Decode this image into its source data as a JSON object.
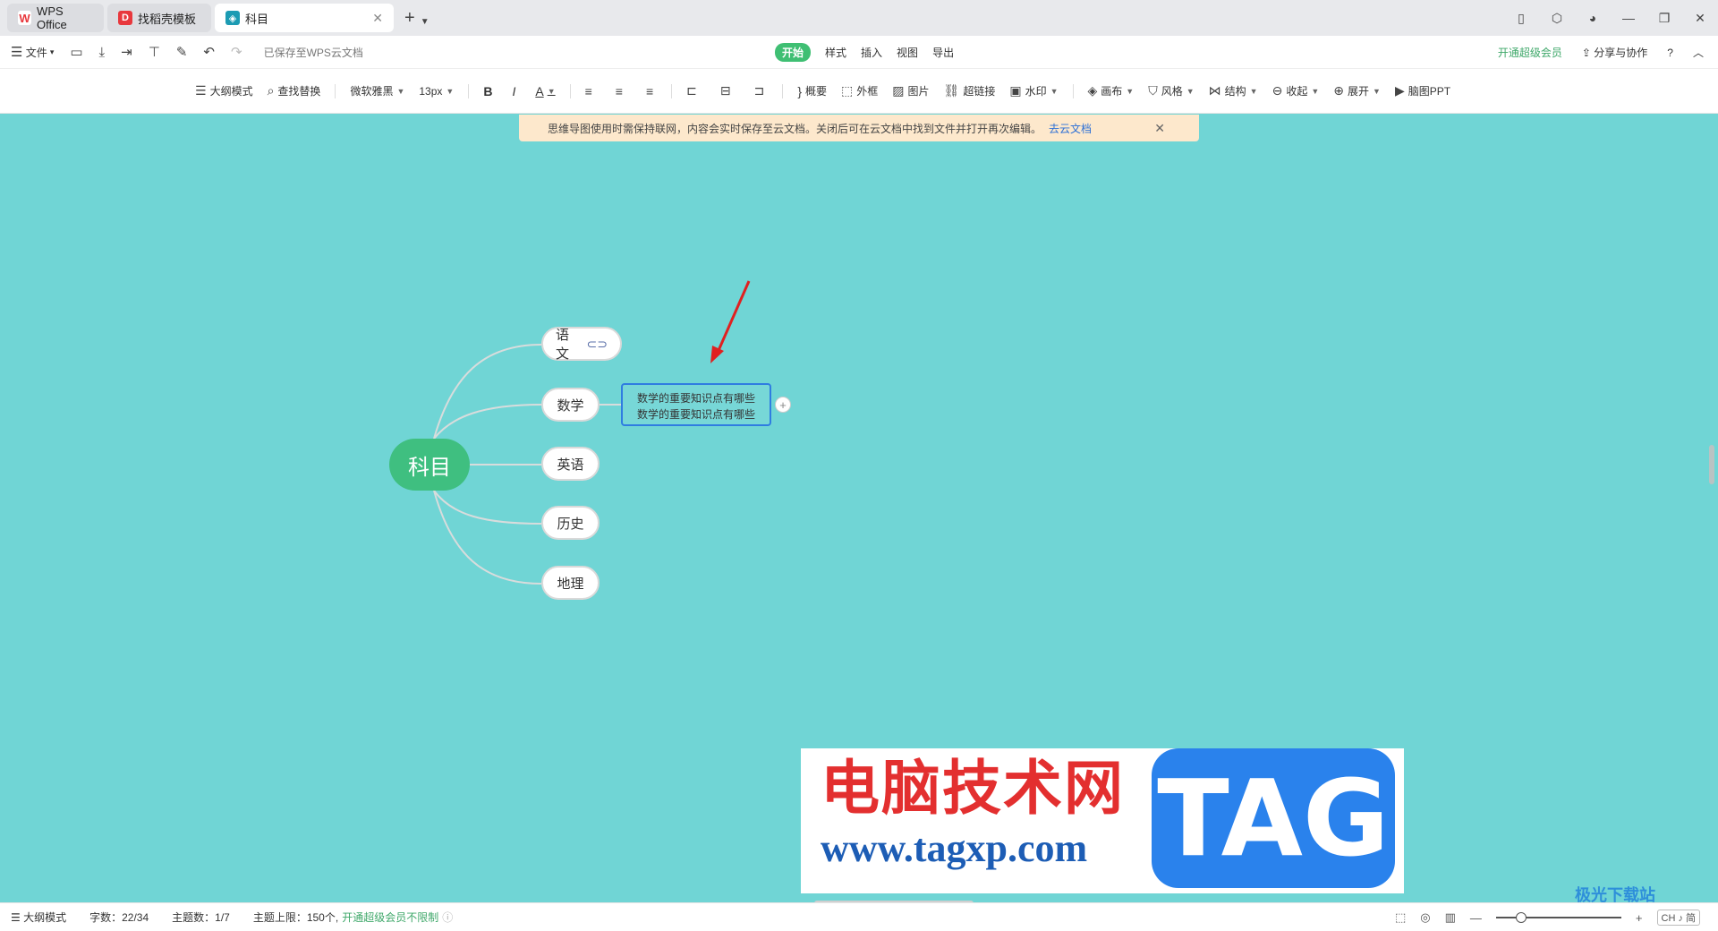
{
  "tabs": [
    {
      "label": "WPS Office",
      "icon": "wps-logo-icon",
      "color": "#e8383d",
      "active": false
    },
    {
      "label": "找稻壳模板",
      "icon": "docer-icon",
      "color": "#e8383d",
      "active": false
    },
    {
      "label": "科目",
      "icon": "mindmap-file-icon",
      "color": "#1c9bb3",
      "active": true
    }
  ],
  "menu": {
    "file_label": "文件",
    "saved_status": "已保存至WPS云文档",
    "tabs": [
      "开始",
      "样式",
      "插入",
      "视图",
      "导出"
    ],
    "active_tab": "开始",
    "vip_label": "开通超级会员",
    "share_label": "分享与协作",
    "help_label": "?"
  },
  "toolbar": {
    "outline": "大纲模式",
    "find_replace": "查找替换",
    "font_family": "微软雅黑",
    "font_size": "13px",
    "bold": "B",
    "italic": "I",
    "font_color": "A",
    "summary": "概要",
    "frame": "外框",
    "image": "图片",
    "hyperlink": "超链接",
    "watermark": "水印",
    "canvas": "画布",
    "style": "风格",
    "structure": "结构",
    "collapse": "收起",
    "expand": "展开",
    "to_ppt": "脑图PPT"
  },
  "notice": {
    "text": "思维导图使用时需保持联网，内容会实时保存至云文档。关闭后可在云文档中找到文件并打开再次编辑。",
    "link": "去云文档"
  },
  "mindmap": {
    "root": "科目",
    "branches": [
      "语文",
      "数学",
      "英语",
      "历史",
      "地理"
    ],
    "link_icon_on": "语文",
    "note_lines": [
      "数学的重要知识点有哪些",
      "数学的重要知识点有哪些"
    ],
    "colors": {
      "canvas": "#70d5d5",
      "root": "#3fbf80",
      "note_border": "#2f7de1",
      "arrow": "#e02020"
    }
  },
  "watermark": {
    "title": "电脑技术网",
    "url": "www.tagxp.com",
    "badge": "TAG"
  },
  "status": {
    "outline": "大纲模式",
    "word_count": "字数：22/34",
    "topic_count": "主题数：1/7",
    "topic_limit": "主题上限：150个,",
    "vip_unlimited": "开通超级会员不限制",
    "ime": "CH ♪ 简",
    "corner_logo": "极光下载站"
  }
}
